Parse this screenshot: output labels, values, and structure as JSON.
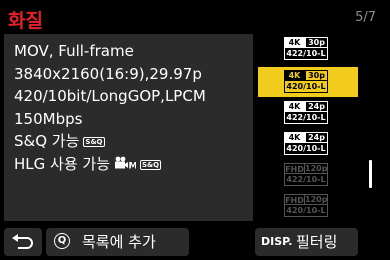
{
  "header": {
    "title": "화질",
    "page": "5/7"
  },
  "info": {
    "lines": [
      "MOV, Full-frame",
      "3840x2160(16:9),29.97p",
      "420/10bit/LongGOP,LPCM",
      "150Mbps",
      "S&Q 가능",
      "HLG 사용 가능"
    ],
    "sq_badge": "S&Q"
  },
  "formats": [
    {
      "res": "4K",
      "fps": "30p",
      "codec": "422/10-L",
      "state": "normal"
    },
    {
      "res": "4K",
      "fps": "30p",
      "codec": "420/10-L",
      "state": "selected"
    },
    {
      "res": "4K",
      "fps": "24p",
      "codec": "422/10-L",
      "state": "normal"
    },
    {
      "res": "4K",
      "fps": "24p",
      "codec": "420/10-L",
      "state": "normal"
    },
    {
      "res": "FHD",
      "fps": "120p",
      "codec": "422/10-L",
      "state": "disabled"
    },
    {
      "res": "FHD",
      "fps": "120p",
      "codec": "420/10-L",
      "state": "disabled"
    }
  ],
  "footer": {
    "back_icon": "return-arrow-icon",
    "q_key": "Q",
    "add_label": "목록에 추가",
    "disp_key": "DISP.",
    "filter_label": "필터링"
  },
  "colors": {
    "title": "#e8202a",
    "selection": "#f2cc1d",
    "panel": "#2b2b2b"
  }
}
